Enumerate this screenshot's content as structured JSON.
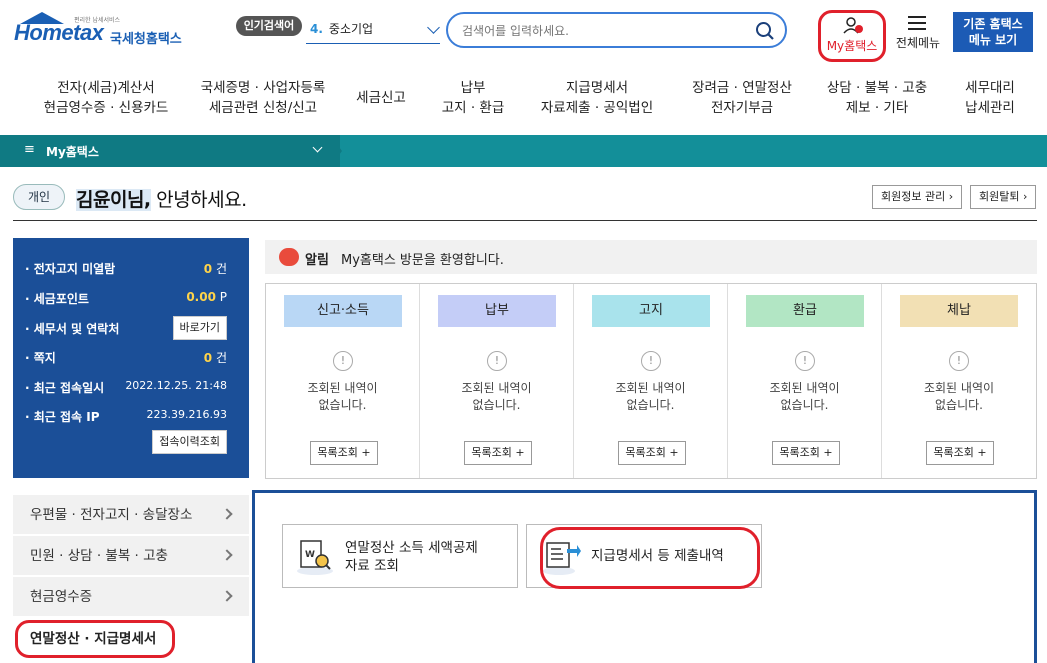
{
  "header": {
    "logo_text": "Hometax",
    "logo_tagline": "편리한 납세서비스",
    "logo_subtitle": "국세청홈택스",
    "popular_badge": "인기검색어",
    "popular_rank": "4.",
    "popular_term": "중소기업",
    "search_placeholder": "검색어를 입력하세요.",
    "my_hometax_label": "My홈택스",
    "all_menu_label": "전체메뉴",
    "old_menu_label_1": "기존 홈택스",
    "old_menu_label_2": "메뉴 보기"
  },
  "gnb": [
    {
      "label": "전자(세금)계산서\n현금영수증 · 신용카드"
    },
    {
      "label": "국세증명 · 사업자등록\n세금관련 신청/신고"
    },
    {
      "label": "세금신고"
    },
    {
      "label": "납부\n고지 · 환급"
    },
    {
      "label": "지급명세서\n자료제출 · 공익법인"
    },
    {
      "label": "장려금 · 연말정산\n전자기부금"
    },
    {
      "label": "상담 · 불복 · 고충\n제보 · 기타"
    },
    {
      "label": "세무대리\n납세관리"
    }
  ],
  "breadcrumb": {
    "label": "My홈택스"
  },
  "greeting": {
    "user_type": "개인",
    "name": "김윤이님,",
    "text": " 안녕하세요.",
    "member_info_btn": "회원정보 관리",
    "withdraw_btn": "회원탈퇴"
  },
  "info": {
    "rows": [
      {
        "label": "전자고지 미열람",
        "value": "0",
        "unit": "건"
      },
      {
        "label": "세금포인트",
        "value": "0.00",
        "unit": "P"
      },
      {
        "label": "세무서 및 연락처",
        "button": "바로가기"
      },
      {
        "label": "쪽지",
        "value": "0",
        "unit": "건"
      },
      {
        "label": "최근 접속일시",
        "text": "2022.12.25.  21:48"
      },
      {
        "label": "최근 접속 IP",
        "text": "223.39.216.93"
      }
    ],
    "history_button": "접속이력조회"
  },
  "notice": {
    "tag": "알림",
    "message": "My홈택스 방문을 환영합니다."
  },
  "cards": [
    {
      "title": "신고·소득",
      "color": "#b9d7f5",
      "message": "조회된 내역이\n없습니다.",
      "button": "목록조회 +"
    },
    {
      "title": "납부",
      "color": "#c4cdf7",
      "message": "조회된 내역이\n없습니다.",
      "button": "목록조회 +"
    },
    {
      "title": "고지",
      "color": "#a9e3ec",
      "message": "조회된 내역이\n없습니다.",
      "button": "목록조회 +"
    },
    {
      "title": "환급",
      "color": "#b2e6c4",
      "message": "조회된 내역이\n없습니다.",
      "button": "목록조회 +"
    },
    {
      "title": "체납",
      "color": "#f2e0b4",
      "message": "조회된 내역이\n없습니다.",
      "button": "목록조회 +"
    }
  ],
  "side_menu": [
    {
      "label": "우편물 · 전자고지 · 송달장소"
    },
    {
      "label": "민원 · 상담 · 불복 · 고충"
    },
    {
      "label": "현금영수증"
    }
  ],
  "side_active": "연말정산 · 지급명세서",
  "tiles": [
    {
      "label": "연말정산 소득 세액공제\n자료 조회",
      "icon": "document-search-icon"
    },
    {
      "label": "지급명세서 등 제출내역",
      "icon": "document-submit-icon"
    }
  ],
  "colors": {
    "brand": "#1a5fb4",
    "teal": "#138f99",
    "highlight": "#e0202b",
    "panel": "#1b4f98"
  }
}
